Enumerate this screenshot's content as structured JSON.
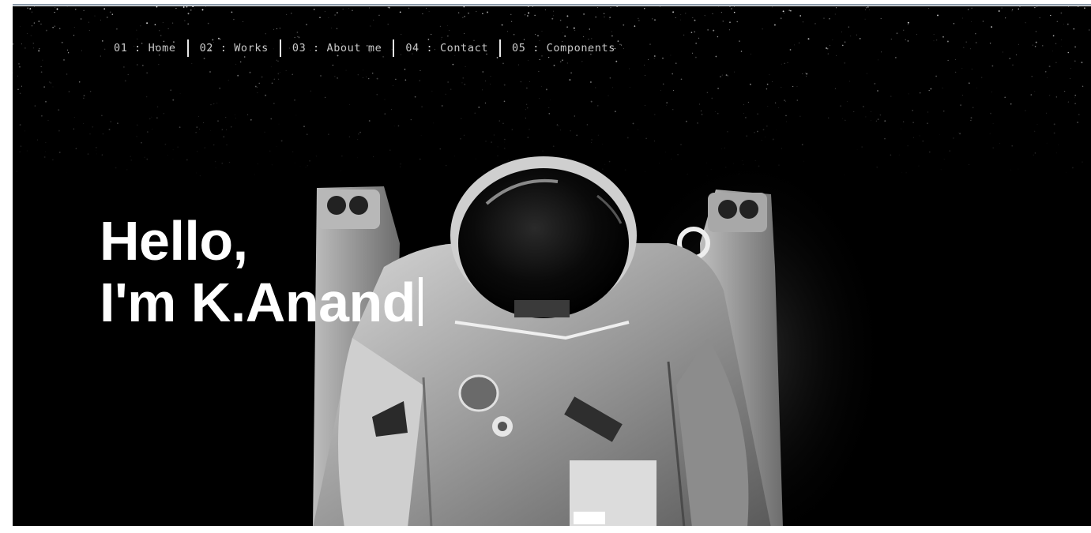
{
  "nav": {
    "items": [
      {
        "label": "01 : Home"
      },
      {
        "label": "02 : Works"
      },
      {
        "label": "03 : About me"
      },
      {
        "label": "04 : Contact"
      },
      {
        "label": "05 : Components"
      }
    ]
  },
  "hero": {
    "line1": "Hello,",
    "line2": "I'm K.Anand"
  },
  "colors": {
    "background": "#000000",
    "text": "#ffffff",
    "nav_text": "#c9c9c9"
  }
}
